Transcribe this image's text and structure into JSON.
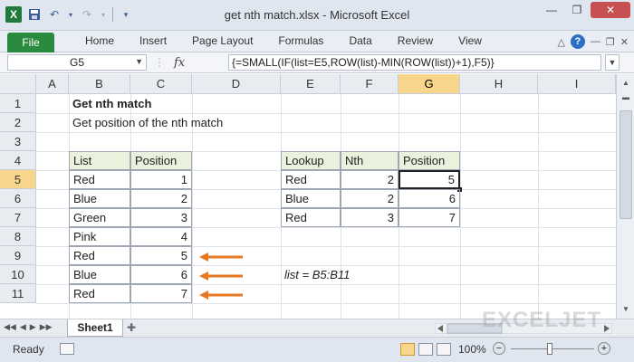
{
  "window": {
    "title": "get nth match.xlsx - Microsoft Excel"
  },
  "qat": {
    "logo": "X",
    "save_icon": "save-icon",
    "undo_icon": "undo-icon",
    "redo_icon": "redo-icon"
  },
  "ribbon": {
    "file_tab": "File",
    "tabs": [
      "Home",
      "Insert",
      "Page Layout",
      "Formulas",
      "Data",
      "Review",
      "View"
    ]
  },
  "formula_bar": {
    "name_box": "G5",
    "fx": "fx",
    "formula": "{=SMALL(IF(list=E5,ROW(list)-MIN(ROW(list))+1),F5)}"
  },
  "columns": [
    "A",
    "B",
    "C",
    "D",
    "E",
    "F",
    "G",
    "H",
    "I"
  ],
  "rows": [
    "1",
    "2",
    "3",
    "4",
    "5",
    "6",
    "7",
    "8",
    "9",
    "10",
    "11"
  ],
  "sheet": {
    "title": "Get nth match",
    "subtitle": "Get position of the nth match",
    "list_table": {
      "headers": [
        "List",
        "Position"
      ],
      "rows": [
        [
          "Red",
          "1"
        ],
        [
          "Blue",
          "2"
        ],
        [
          "Green",
          "3"
        ],
        [
          "Pink",
          "4"
        ],
        [
          "Red",
          "5"
        ],
        [
          "Blue",
          "6"
        ],
        [
          "Red",
          "7"
        ]
      ]
    },
    "lookup_table": {
      "headers": [
        "Lookup",
        "Nth",
        "Position"
      ],
      "rows": [
        [
          "Red",
          "2",
          "5"
        ],
        [
          "Blue",
          "2",
          "6"
        ],
        [
          "Red",
          "3",
          "7"
        ]
      ]
    },
    "note": "list = B5:B11",
    "arrow_color": "#e87722"
  },
  "sheet_tabs": {
    "active": "Sheet1"
  },
  "watermark": "EXCELJET",
  "status_bar": {
    "status": "Ready",
    "zoom": "100%"
  },
  "colors": {
    "accent_green": "#2a8a3e",
    "selection": "#f7d58a",
    "header_fill": "#eaf1dd"
  }
}
